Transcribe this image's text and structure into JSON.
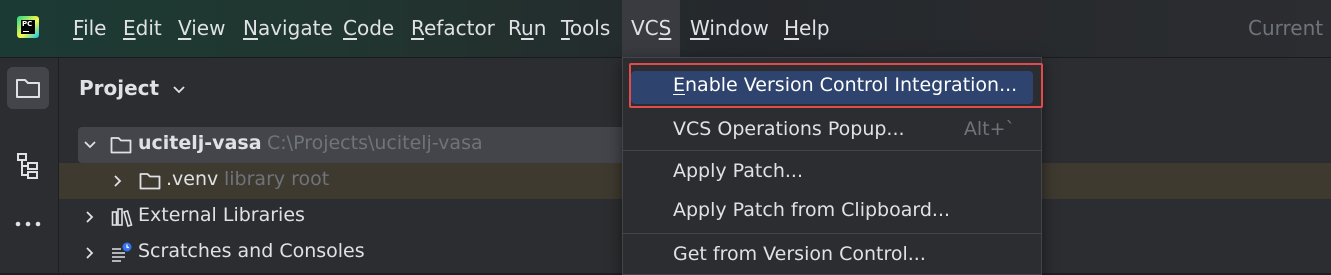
{
  "app": {
    "logo_text": "PC",
    "window_title_partial": "Current F"
  },
  "menubar": {
    "items": [
      {
        "mn": "F",
        "rest": "ile"
      },
      {
        "mn": "E",
        "rest": "dit"
      },
      {
        "mn": "V",
        "rest": "iew"
      },
      {
        "mn": "N",
        "rest": "avigate"
      },
      {
        "mn": "C",
        "rest": "ode"
      },
      {
        "mn": "R",
        "rest": "efactor"
      },
      {
        "pre": "R",
        "mn": "u",
        "rest": "n"
      },
      {
        "mn": "T",
        "rest": "ools"
      },
      {
        "pre": "VC",
        "mn": "S",
        "rest": ""
      },
      {
        "mn": "W",
        "rest": "indow"
      },
      {
        "mn": "H",
        "rest": "elp"
      }
    ]
  },
  "project_panel": {
    "title": "Project",
    "tree": {
      "root_name": "ucitelj-vasa",
      "root_path": "C:\\Projects\\ucitelj-vasa",
      "venv_name": ".venv",
      "venv_hint": "library root",
      "external_libraries": "External Libraries",
      "scratches": "Scratches and Consoles"
    }
  },
  "vcs_menu": {
    "items": [
      {
        "mn": "E",
        "rest": "nable Version Control Integration...",
        "shortcut": ""
      },
      {
        "mn": "",
        "rest": "VCS Operations Popup...",
        "shortcut": "Alt+`"
      },
      {
        "mn": "",
        "rest": "Apply Patch...",
        "shortcut": ""
      },
      {
        "mn": "",
        "rest": "Apply Patch from Clipboard...",
        "shortcut": ""
      },
      {
        "mn": "",
        "rest": "Get from Version Control...",
        "shortcut": ""
      }
    ]
  },
  "colors": {
    "highlight_box": "#e24b4b",
    "selection": "#2e436e",
    "background": "#2b2d30"
  },
  "icons": [
    "folder-icon",
    "structure-icon",
    "more-icon",
    "chevron-down-icon",
    "chevron-right-icon",
    "library-icon",
    "scratches-icon"
  ]
}
